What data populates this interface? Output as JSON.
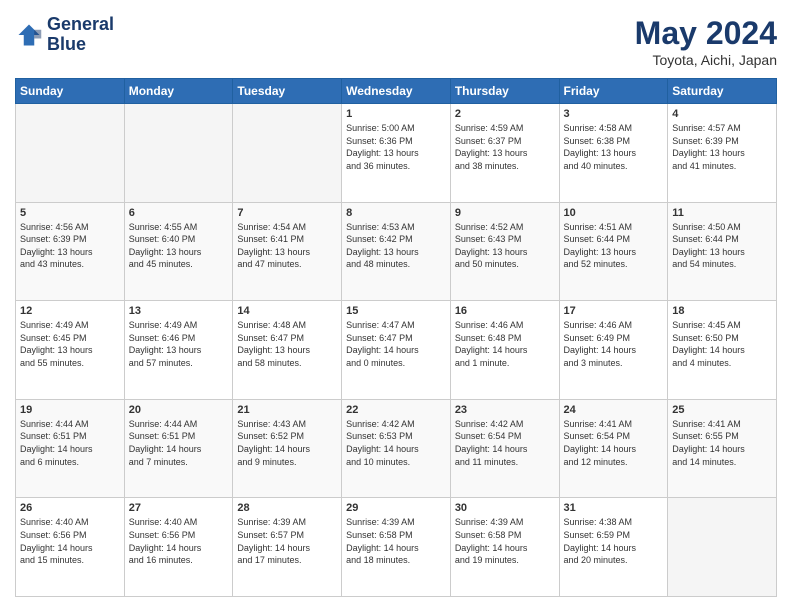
{
  "header": {
    "logo_line1": "General",
    "logo_line2": "Blue",
    "title": "May 2024",
    "subtitle": "Toyota, Aichi, Japan"
  },
  "days_of_week": [
    "Sunday",
    "Monday",
    "Tuesday",
    "Wednesday",
    "Thursday",
    "Friday",
    "Saturday"
  ],
  "weeks": [
    [
      {
        "day": "",
        "info": ""
      },
      {
        "day": "",
        "info": ""
      },
      {
        "day": "",
        "info": ""
      },
      {
        "day": "1",
        "info": "Sunrise: 5:00 AM\nSunset: 6:36 PM\nDaylight: 13 hours\nand 36 minutes."
      },
      {
        "day": "2",
        "info": "Sunrise: 4:59 AM\nSunset: 6:37 PM\nDaylight: 13 hours\nand 38 minutes."
      },
      {
        "day": "3",
        "info": "Sunrise: 4:58 AM\nSunset: 6:38 PM\nDaylight: 13 hours\nand 40 minutes."
      },
      {
        "day": "4",
        "info": "Sunrise: 4:57 AM\nSunset: 6:39 PM\nDaylight: 13 hours\nand 41 minutes."
      }
    ],
    [
      {
        "day": "5",
        "info": "Sunrise: 4:56 AM\nSunset: 6:39 PM\nDaylight: 13 hours\nand 43 minutes."
      },
      {
        "day": "6",
        "info": "Sunrise: 4:55 AM\nSunset: 6:40 PM\nDaylight: 13 hours\nand 45 minutes."
      },
      {
        "day": "7",
        "info": "Sunrise: 4:54 AM\nSunset: 6:41 PM\nDaylight: 13 hours\nand 47 minutes."
      },
      {
        "day": "8",
        "info": "Sunrise: 4:53 AM\nSunset: 6:42 PM\nDaylight: 13 hours\nand 48 minutes."
      },
      {
        "day": "9",
        "info": "Sunrise: 4:52 AM\nSunset: 6:43 PM\nDaylight: 13 hours\nand 50 minutes."
      },
      {
        "day": "10",
        "info": "Sunrise: 4:51 AM\nSunset: 6:44 PM\nDaylight: 13 hours\nand 52 minutes."
      },
      {
        "day": "11",
        "info": "Sunrise: 4:50 AM\nSunset: 6:44 PM\nDaylight: 13 hours\nand 54 minutes."
      }
    ],
    [
      {
        "day": "12",
        "info": "Sunrise: 4:49 AM\nSunset: 6:45 PM\nDaylight: 13 hours\nand 55 minutes."
      },
      {
        "day": "13",
        "info": "Sunrise: 4:49 AM\nSunset: 6:46 PM\nDaylight: 13 hours\nand 57 minutes."
      },
      {
        "day": "14",
        "info": "Sunrise: 4:48 AM\nSunset: 6:47 PM\nDaylight: 13 hours\nand 58 minutes."
      },
      {
        "day": "15",
        "info": "Sunrise: 4:47 AM\nSunset: 6:47 PM\nDaylight: 14 hours\nand 0 minutes."
      },
      {
        "day": "16",
        "info": "Sunrise: 4:46 AM\nSunset: 6:48 PM\nDaylight: 14 hours\nand 1 minute."
      },
      {
        "day": "17",
        "info": "Sunrise: 4:46 AM\nSunset: 6:49 PM\nDaylight: 14 hours\nand 3 minutes."
      },
      {
        "day": "18",
        "info": "Sunrise: 4:45 AM\nSunset: 6:50 PM\nDaylight: 14 hours\nand 4 minutes."
      }
    ],
    [
      {
        "day": "19",
        "info": "Sunrise: 4:44 AM\nSunset: 6:51 PM\nDaylight: 14 hours\nand 6 minutes."
      },
      {
        "day": "20",
        "info": "Sunrise: 4:44 AM\nSunset: 6:51 PM\nDaylight: 14 hours\nand 7 minutes."
      },
      {
        "day": "21",
        "info": "Sunrise: 4:43 AM\nSunset: 6:52 PM\nDaylight: 14 hours\nand 9 minutes."
      },
      {
        "day": "22",
        "info": "Sunrise: 4:42 AM\nSunset: 6:53 PM\nDaylight: 14 hours\nand 10 minutes."
      },
      {
        "day": "23",
        "info": "Sunrise: 4:42 AM\nSunset: 6:54 PM\nDaylight: 14 hours\nand 11 minutes."
      },
      {
        "day": "24",
        "info": "Sunrise: 4:41 AM\nSunset: 6:54 PM\nDaylight: 14 hours\nand 12 minutes."
      },
      {
        "day": "25",
        "info": "Sunrise: 4:41 AM\nSunset: 6:55 PM\nDaylight: 14 hours\nand 14 minutes."
      }
    ],
    [
      {
        "day": "26",
        "info": "Sunrise: 4:40 AM\nSunset: 6:56 PM\nDaylight: 14 hours\nand 15 minutes."
      },
      {
        "day": "27",
        "info": "Sunrise: 4:40 AM\nSunset: 6:56 PM\nDaylight: 14 hours\nand 16 minutes."
      },
      {
        "day": "28",
        "info": "Sunrise: 4:39 AM\nSunset: 6:57 PM\nDaylight: 14 hours\nand 17 minutes."
      },
      {
        "day": "29",
        "info": "Sunrise: 4:39 AM\nSunset: 6:58 PM\nDaylight: 14 hours\nand 18 minutes."
      },
      {
        "day": "30",
        "info": "Sunrise: 4:39 AM\nSunset: 6:58 PM\nDaylight: 14 hours\nand 19 minutes."
      },
      {
        "day": "31",
        "info": "Sunrise: 4:38 AM\nSunset: 6:59 PM\nDaylight: 14 hours\nand 20 minutes."
      },
      {
        "day": "",
        "info": ""
      }
    ]
  ]
}
